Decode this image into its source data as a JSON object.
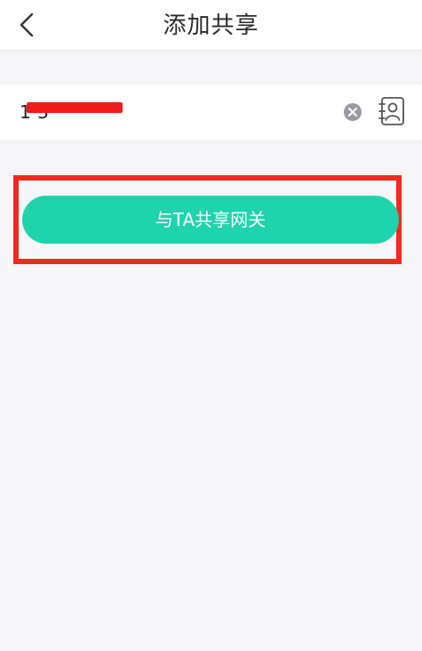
{
  "header": {
    "title": "添加共享",
    "back_icon": "chevron-left-icon"
  },
  "input": {
    "value": "1        3",
    "clear_icon": "clear-circle-icon",
    "contacts_icon": "contacts-book-icon"
  },
  "actions": {
    "share_label": "与TA共享网关"
  },
  "colors": {
    "accent": "#1fd3ad",
    "highlight": "#ee2b1e",
    "background": "#f6f6f8",
    "redaction": "#ee1c1c"
  }
}
